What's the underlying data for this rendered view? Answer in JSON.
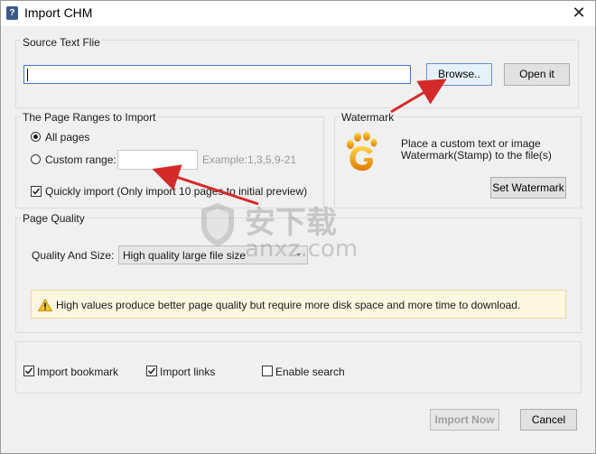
{
  "window": {
    "title": "Import CHM",
    "close_glyph": "✕"
  },
  "source": {
    "group_title": "Source Text Flie",
    "path_value": "",
    "browse_label": "Browse..",
    "open_label": "Open it"
  },
  "ranges": {
    "group_title": "The Page Ranges to Import",
    "all_pages_label": "All pages",
    "all_pages_selected": true,
    "custom_range_label": "Custom range:",
    "custom_range_value": "",
    "example_text": "Example:1,3,5,9-21",
    "quick_import_label": "Quickly import (Only import 10 pages to initial  preview)",
    "quick_import_checked": true
  },
  "watermark": {
    "group_title": "Watermark",
    "description_line1": "Place a custom text or image",
    "description_line2": "Watermark(Stamp) to the file(s)",
    "set_button_label": "Set Watermark",
    "icon": "paw-logo-icon"
  },
  "quality": {
    "group_title": "Page Quality",
    "quality_label": "Quality And Size:",
    "quality_value": "High quality large file size",
    "notice_text": "High values produce better page quality but require more disk space and more time to download.",
    "notice_icon": "warning-icon"
  },
  "options": {
    "import_bookmark_label": "Import bookmark",
    "import_bookmark_checked": true,
    "import_links_label": "Import links",
    "import_links_checked": true,
    "enable_search_label": "Enable search",
    "enable_search_checked": false
  },
  "footer": {
    "import_now_label": "Import Now",
    "cancel_label": "Cancel"
  },
  "overlay": {
    "site_watermark_cn": "安下载",
    "site_watermark_en": "anxz.com"
  },
  "colors": {
    "annotation_arrow": "#d42a2a",
    "focus_border": "#3d78c6"
  }
}
